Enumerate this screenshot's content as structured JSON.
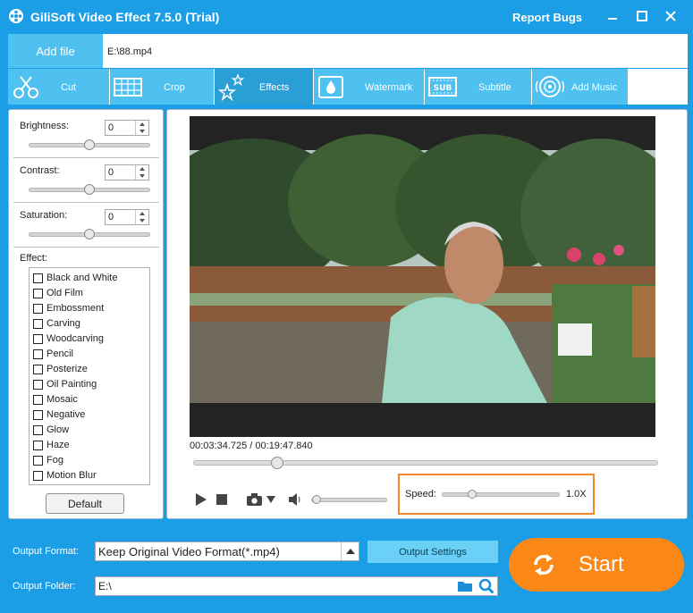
{
  "window": {
    "title": "GiliSoft Video Effect 7.5.0 (Trial)",
    "report_bugs": "Report Bugs"
  },
  "toolbar": {
    "add_file": "Add file",
    "file_path": "E:\\88.mp4"
  },
  "tabs": [
    {
      "label": "Cut",
      "icon": "scissors-icon",
      "active": false
    },
    {
      "label": "Crop",
      "icon": "crop-icon",
      "active": false
    },
    {
      "label": "Effects",
      "icon": "stars-icon",
      "active": true
    },
    {
      "label": "Watermark",
      "icon": "watermark-drop-icon",
      "active": false
    },
    {
      "label": "Subtitle",
      "icon": "subtitle-icon",
      "active": false
    },
    {
      "label": "Add Music",
      "icon": "music-icon",
      "active": false
    }
  ],
  "adjustments": {
    "brightness": {
      "label": "Brightness:",
      "value": "0",
      "level": 0.5
    },
    "contrast": {
      "label": "Contrast:",
      "value": "0",
      "level": 0.5
    },
    "saturation": {
      "label": "Saturation:",
      "value": "0",
      "level": 0.5
    }
  },
  "effects": {
    "label": "Effect:",
    "items": [
      {
        "label": "Black and White",
        "checked": false
      },
      {
        "label": "Old Film",
        "checked": false
      },
      {
        "label": "Embossment",
        "checked": false
      },
      {
        "label": "Carving",
        "checked": false
      },
      {
        "label": "Woodcarving",
        "checked": false
      },
      {
        "label": "Pencil",
        "checked": false
      },
      {
        "label": "Posterize",
        "checked": false
      },
      {
        "label": "Oil Painting",
        "checked": false
      },
      {
        "label": "Mosaic",
        "checked": false
      },
      {
        "label": "Negative",
        "checked": false
      },
      {
        "label": "Glow",
        "checked": false
      },
      {
        "label": "Haze",
        "checked": false
      },
      {
        "label": "Fog",
        "checked": false
      },
      {
        "label": "Motion Blur",
        "checked": false
      }
    ],
    "default_button": "Default"
  },
  "player": {
    "timecode": "00:03:34.725 / 00:19:47.840",
    "progress": 0.18,
    "volume_level": 0.0,
    "speed_label": "Speed:",
    "speed_value": "1.0X",
    "speed_level": 0.25
  },
  "output": {
    "format_label": "Output Format:",
    "format_value": "Keep Original Video Format(*.mp4)",
    "settings_button": "Output Settings",
    "folder_label": "Output Folder:",
    "folder_value": "E:\\",
    "start_button": "Start"
  },
  "colors": {
    "titlebar": "#1b9ee6",
    "tab": "#4ec1f0",
    "tab_active": "#2a9fd6",
    "start": "#fb8717",
    "speed_highlight": "#f08a2a"
  }
}
